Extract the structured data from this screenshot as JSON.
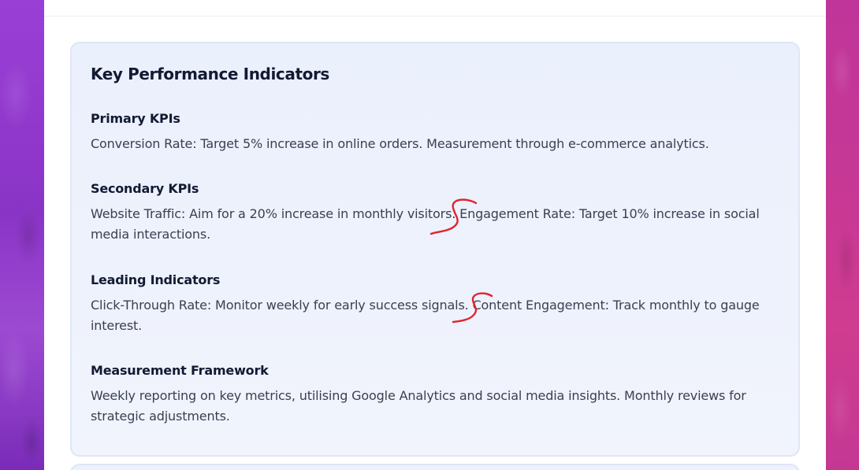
{
  "kpi_card": {
    "title": "Key Performance Indicators",
    "sections": [
      {
        "title": "Primary KPIs",
        "text": "Conversion Rate: Target 5% increase in online orders. Measurement through e-commerce analytics."
      },
      {
        "title": "Secondary KPIs",
        "text": "Website Traffic: Aim for a 20% increase in monthly visitors. Engagement Rate: Target 10% increase in social media interactions."
      },
      {
        "title": "Leading Indicators",
        "text": "Click-Through Rate: Monitor weekly for early success signals. Content Engagement: Track monthly to gauge interest."
      },
      {
        "title": "Measurement Framework",
        "text": "Weekly reporting on key metrics, utilising Google Analytics and social media insights. Monthly reviews for strategic adjustments."
      }
    ]
  },
  "annotations": {
    "mark_color": "#e0242f",
    "mark_type": "red-s-shaped-pen-mark"
  },
  "colors": {
    "background_left": "#8a34c6",
    "background_right": "#c73895",
    "card_bg": "#ebf0fd",
    "card_border": "#dfe6f8",
    "heading": "#121a33",
    "body_text": "#3a3f52"
  }
}
